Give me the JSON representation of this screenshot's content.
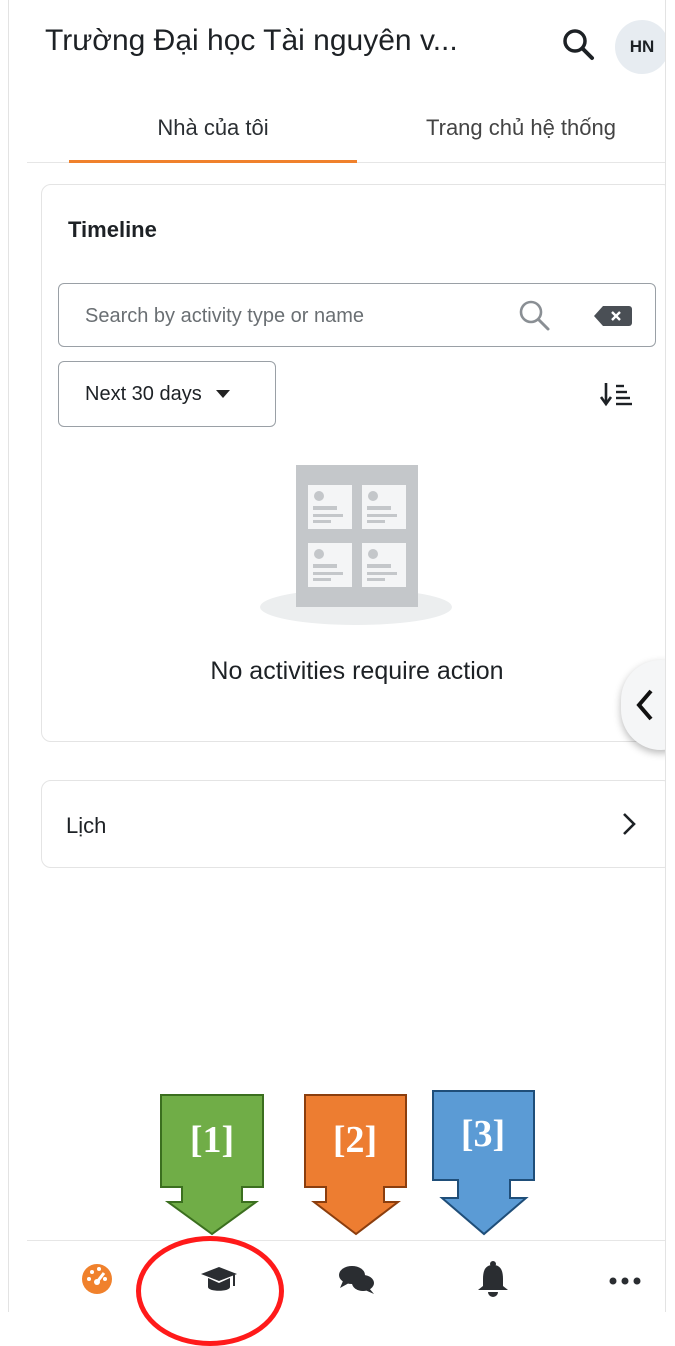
{
  "header": {
    "app_title": "Trường Đại học Tài nguyên v...",
    "avatar_initials": "HN",
    "icons": {
      "search": "search-icon"
    }
  },
  "tabs": [
    {
      "label": "Nhà của tôi",
      "active": true
    },
    {
      "label": "Trang chủ hệ thống",
      "active": false
    }
  ],
  "timeline": {
    "title": "Timeline",
    "search_placeholder": "Search by activity type or name",
    "filter_selected": "Next 30 days",
    "empty_message": "No activities require action"
  },
  "calendar": {
    "title": "Lịch"
  },
  "annotations": [
    {
      "label": "[1]",
      "color": "#70ad47"
    },
    {
      "label": "[2]",
      "color": "#ed7d31"
    },
    {
      "label": "[3]",
      "color": "#5b9bd5"
    }
  ],
  "bottom_nav": [
    {
      "icon": "dashboard-icon",
      "active": true
    },
    {
      "icon": "courses-graduation-cap-icon",
      "active": false
    },
    {
      "icon": "messages-icon",
      "active": false
    },
    {
      "icon": "notifications-bell-icon",
      "active": false
    },
    {
      "icon": "more-icon",
      "active": false
    }
  ],
  "colors": {
    "accent": "#f0812c",
    "highlight": "#ff1a1a",
    "annotation_1": "#70ad47",
    "annotation_2": "#ed7d31",
    "annotation_3": "#5b9bd5"
  }
}
